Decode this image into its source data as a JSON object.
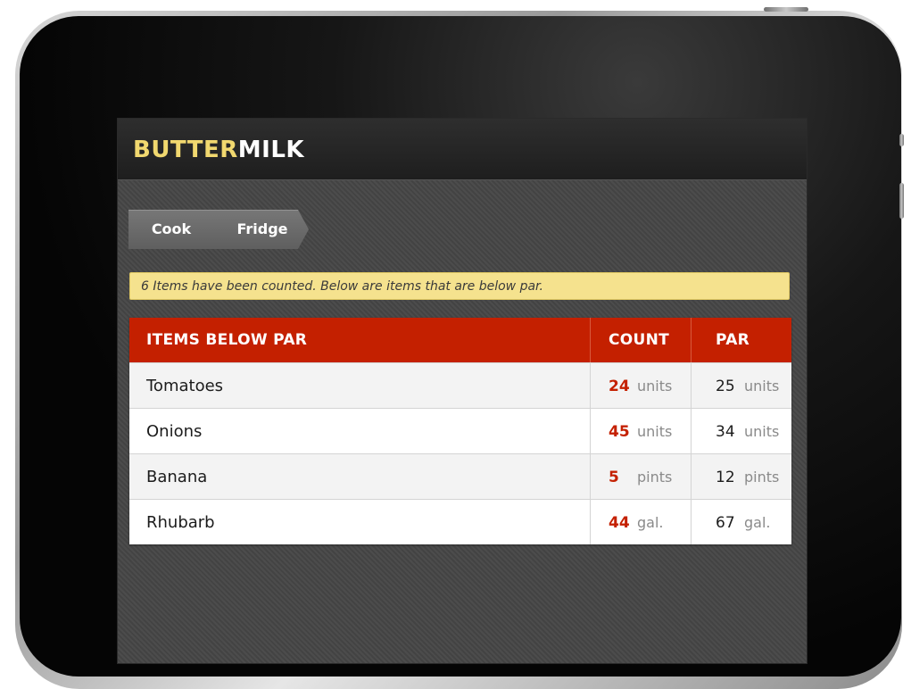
{
  "app": {
    "brand_primary": "BUTTER",
    "brand_secondary": "MILK",
    "brand_primary_color": "#f1d86f",
    "brand_secondary_color": "#ffffff",
    "accent_color": "#c42000",
    "notice_color": "#f5e28e"
  },
  "breadcrumb": {
    "items": [
      {
        "label": "Cook"
      },
      {
        "label": "Fridge"
      }
    ]
  },
  "notice": {
    "text": "6 Items have been counted. Below are items that are below par."
  },
  "table": {
    "headers": {
      "name": "ITEMS BELOW PAR",
      "count": "COUNT",
      "par": "PAR"
    },
    "rows": [
      {
        "name": "Tomatoes",
        "count": "24",
        "count_unit": "units",
        "par": "25",
        "par_unit": "units"
      },
      {
        "name": "Onions",
        "count": "45",
        "count_unit": "units",
        "par": "34",
        "par_unit": "units"
      },
      {
        "name": "Banana",
        "count": "5",
        "count_unit": "pints",
        "par": "12",
        "par_unit": "pints"
      },
      {
        "name": "Rhubarb",
        "count": "44",
        "count_unit": "gal.",
        "par": "67",
        "par_unit": "gal."
      }
    ]
  }
}
